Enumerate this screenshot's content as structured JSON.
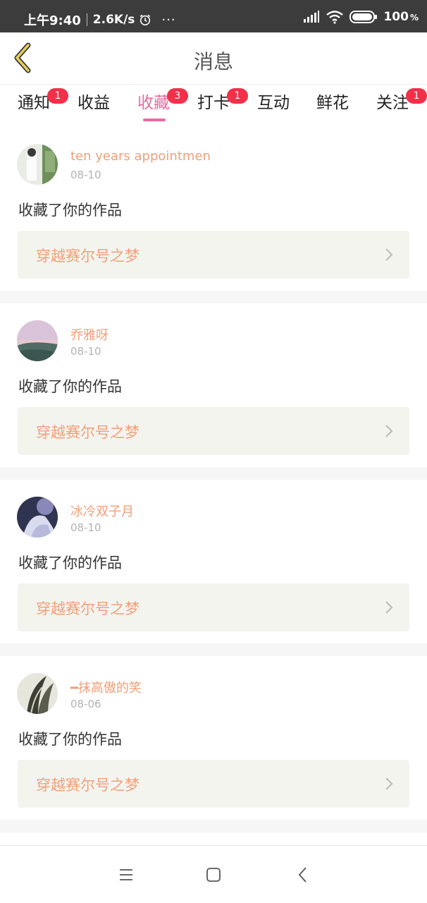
{
  "status_bar": {
    "time": "上午9:40",
    "speed": "2.6K/s",
    "dots": "···",
    "battery": "100",
    "battery_unit": "%"
  },
  "header": {
    "title": "消息"
  },
  "tabs": [
    {
      "label": "通知",
      "badge": "1"
    },
    {
      "label": "收益",
      "badge": ""
    },
    {
      "label": "收藏",
      "badge": "3"
    },
    {
      "label": "打卡",
      "badge": "1"
    },
    {
      "label": "互动",
      "badge": ""
    },
    {
      "label": "鲜花",
      "badge": ""
    },
    {
      "label": "关注",
      "badge": "1"
    }
  ],
  "active_tab": "收藏",
  "feed": [
    {
      "username": "ten years appointmen",
      "date": "08-10",
      "action": "收藏了你的作品",
      "work": "穿越赛尔号之梦"
    },
    {
      "username": "乔雅呀",
      "date": "08-10",
      "action": "收藏了你的作品",
      "work": "穿越赛尔号之梦"
    },
    {
      "username": "冰冷双子月",
      "date": "08-10",
      "action": "收藏了你的作品",
      "work": "穿越赛尔号之梦"
    },
    {
      "username": "━抹高傲的笑",
      "date": "08-06",
      "action": "收藏了你的作品",
      "work": "穿越赛尔号之梦"
    }
  ],
  "colors": {
    "accent_pink": "#ea6aa0",
    "badge_red": "#f2304a",
    "username_orange": "#efa07a",
    "back_arrow": "#d9c24a"
  }
}
